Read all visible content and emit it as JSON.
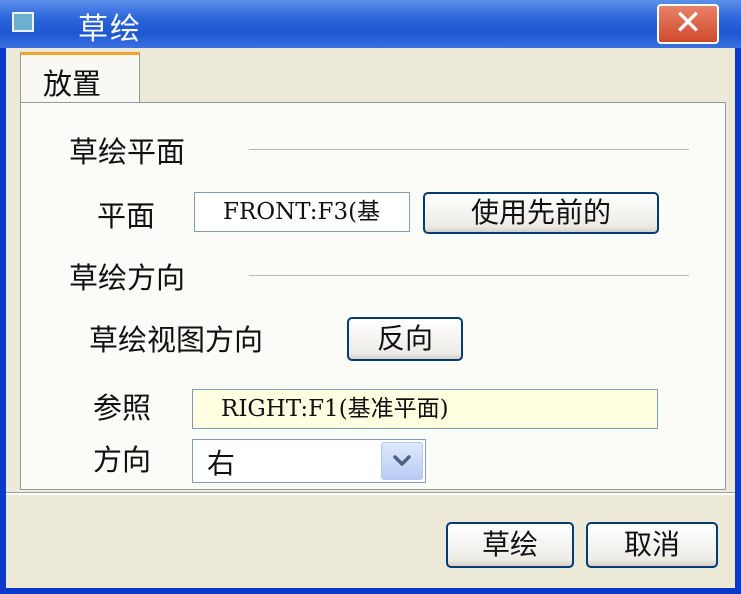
{
  "window": {
    "title": "草绘",
    "close_label": "✕"
  },
  "tabs": [
    {
      "label": "放置"
    }
  ],
  "sketch_plane": {
    "section_label": "草绘平面",
    "plane_label": "平面",
    "plane_value": "FRONT:F3(基",
    "use_previous_label": "使用先前的"
  },
  "sketch_orientation": {
    "section_label": "草绘方向",
    "view_direction_label": "草绘视图方向",
    "flip_label": "反向",
    "reference_label": "参照",
    "reference_value": "RIGHT:F1(基准平面)",
    "orientation_label": "方向",
    "orientation_value": "右"
  },
  "footer": {
    "ok_label": "草绘",
    "cancel_label": "取消"
  },
  "colors": {
    "title_bar": "#2a64d9",
    "reference_field_bg": "#ffffe1",
    "tab_accent": "#f1a531"
  }
}
